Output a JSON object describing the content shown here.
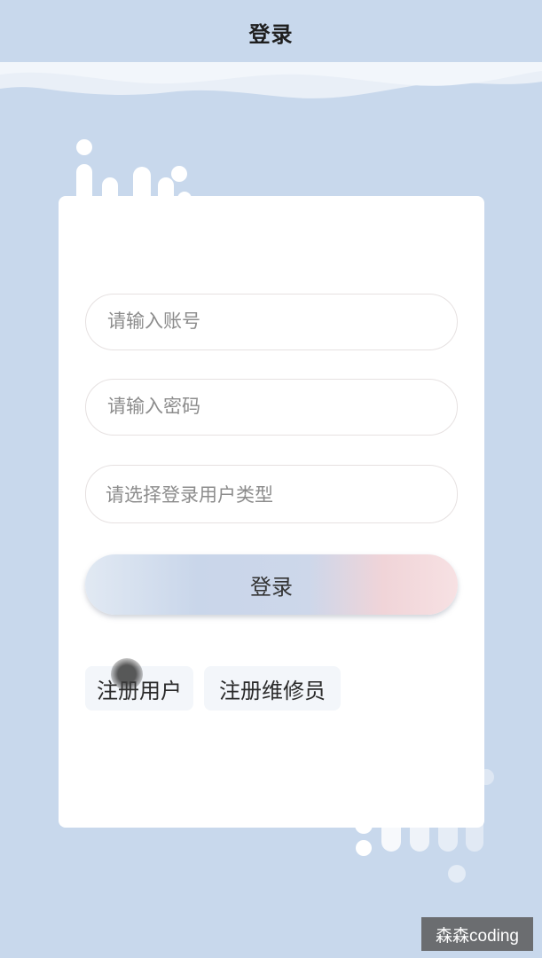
{
  "header": {
    "title": "登录"
  },
  "form": {
    "account_placeholder": "请输入账号",
    "password_placeholder": "请输入密码",
    "user_type_placeholder": "请选择登录用户类型",
    "login_label": "登录"
  },
  "links": {
    "register_user": "注册用户",
    "register_repairer": "注册维修员"
  },
  "watermark": {
    "text": "森森coding"
  },
  "colors": {
    "background": "#c8d8ec",
    "card": "#ffffff",
    "button_left": "#c9d6ea",
    "button_right": "#f0d4d8"
  }
}
